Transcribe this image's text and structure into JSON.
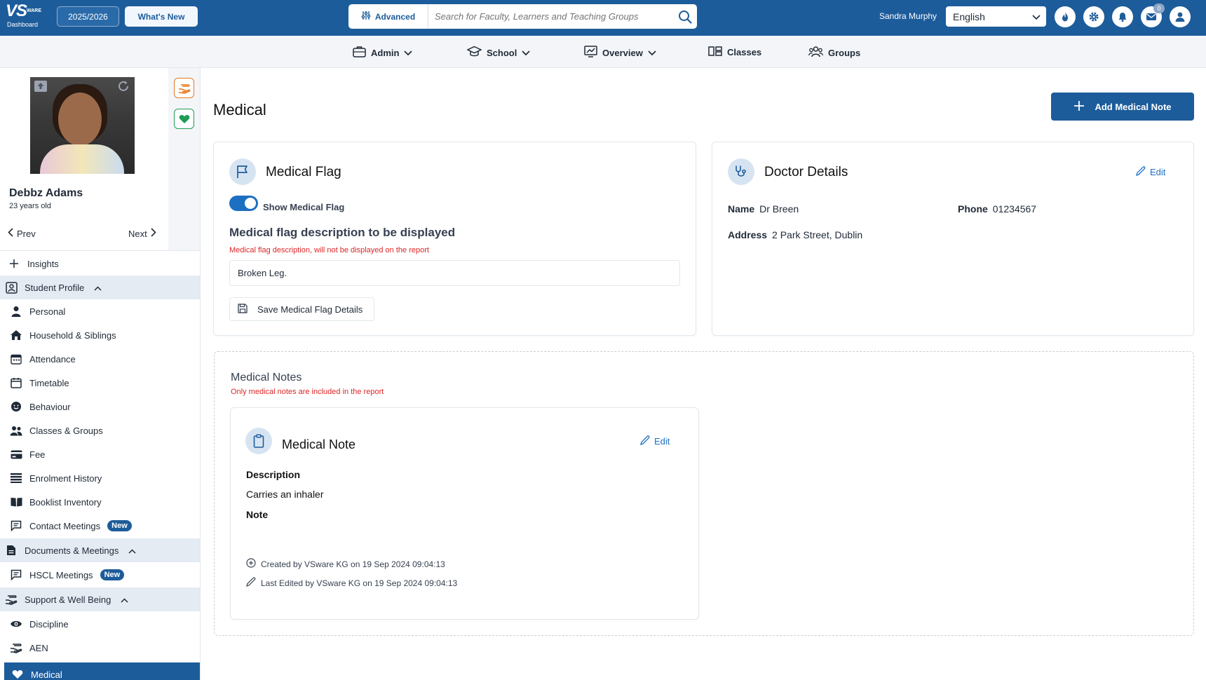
{
  "header": {
    "logo_text": "VS",
    "logo_side": "WARE",
    "logo_caption": "Dashboard",
    "year": "2025/2026",
    "whats_new": "What's New",
    "advanced": "Advanced",
    "search_placeholder": "Search for Faculty, Learners and Teaching Groups",
    "user_name": "Sandra Murphy",
    "language": "English",
    "mail_count": "0"
  },
  "nav": {
    "admin": "Admin",
    "school": "School",
    "overview": "Overview",
    "classes": "Classes",
    "groups": "Groups"
  },
  "student": {
    "name": "Debbz Adams",
    "age": "23 years old",
    "prev": "Prev",
    "next": "Next"
  },
  "sidebar": {
    "insights": "Insights",
    "student_profile": "Student Profile",
    "personal": "Personal",
    "household": "Household & Siblings",
    "attendance": "Attendance",
    "timetable": "Timetable",
    "behaviour": "Behaviour",
    "classes_groups": "Classes & Groups",
    "fee": "Fee",
    "enrolment": "Enrolment History",
    "booklist": "Booklist Inventory",
    "contact_meetings": "Contact Meetings",
    "new_badge": "New",
    "documents_meetings": "Documents & Meetings",
    "hscl": "HSCL Meetings",
    "support": "Support & Well Being",
    "discipline": "Discipline",
    "aen": "AEN",
    "medical": "Medical"
  },
  "main": {
    "title": "Medical",
    "add_button": "Add Medical Note",
    "flag_card": {
      "title": "Medical Flag",
      "toggle_label": "Show Medical Flag",
      "toggle_on": true,
      "desc_title": "Medical flag description to be displayed",
      "desc_note": "Medical flag description, will not be displayed on the report",
      "desc_value": "Broken Leg.",
      "save_label": "Save Medical Flag Details"
    },
    "doctor_card": {
      "title": "Doctor Details",
      "edit": "Edit",
      "name_label": "Name",
      "name_value": "Dr Breen",
      "phone_label": "Phone",
      "phone_value": "01234567",
      "address_label": "Address",
      "address_value": "2 Park Street, Dublin"
    },
    "notes": {
      "title": "Medical Notes",
      "subtitle": "Only medical notes are included in the report",
      "note": {
        "title": "Medical Note",
        "edit": "Edit",
        "description_label": "Description",
        "description_value": "Carries an inhaler",
        "note_label": "Note",
        "created": "Created by VSware KG on 19 Sep 2024 09:04:13",
        "edited": "Last Edited by VSware KG on 19 Sep 2024 09:04:13"
      }
    }
  },
  "colors": {
    "brand": "#1d5c9b",
    "accent": "#1d6fc2",
    "warning_text": "#dc2626",
    "tool_orange": "#e8781c",
    "tool_green": "#1f9d55"
  }
}
